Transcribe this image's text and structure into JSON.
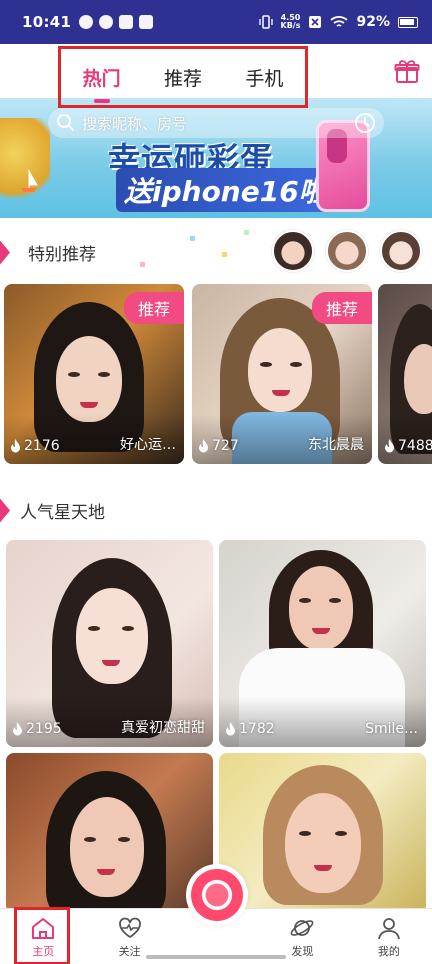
{
  "status_bar": {
    "time": "10:41",
    "net_speed_value": "4.50",
    "net_speed_unit": "KB/s",
    "battery": "92%"
  },
  "top_tabs": [
    {
      "label": "热门",
      "active": true
    },
    {
      "label": "推荐",
      "active": false
    },
    {
      "label": "手机",
      "active": false
    }
  ],
  "gift_icon": "gift-icon",
  "banner": {
    "search_placeholder": "搜索昵称、房号",
    "headline_1": "幸运砸彩蛋",
    "headline_2": "送iphone16啦!"
  },
  "special": {
    "title": "特别推荐",
    "cards": [
      {
        "badge": "推荐",
        "count": "2176",
        "nick": "好心运…"
      },
      {
        "badge": "推荐",
        "count": "727",
        "nick": "东北晨晨"
      },
      {
        "badge": "",
        "count": "7488",
        "nick": ""
      }
    ]
  },
  "popular": {
    "title": "人气星天地",
    "cards": [
      {
        "count": "2195",
        "nick": "真爱初恋甜甜"
      },
      {
        "count": "1782",
        "nick": "Smile…"
      },
      {
        "count": "",
        "nick": ""
      },
      {
        "count": "",
        "nick": ""
      }
    ]
  },
  "bottom_nav": [
    {
      "label": "主页",
      "icon": "home-icon",
      "active": true
    },
    {
      "label": "关注",
      "icon": "heart-pulse-icon",
      "active": false
    },
    {
      "label": "",
      "icon": "camera-live-icon",
      "active": false
    },
    {
      "label": "发现",
      "icon": "planet-icon",
      "active": false
    },
    {
      "label": "我的",
      "icon": "person-icon",
      "active": false
    }
  ],
  "colors": {
    "status_bar": "#2f3192",
    "accent": "#e8397a",
    "highlight_box": "#e0262b",
    "badge": "#f24b83"
  }
}
